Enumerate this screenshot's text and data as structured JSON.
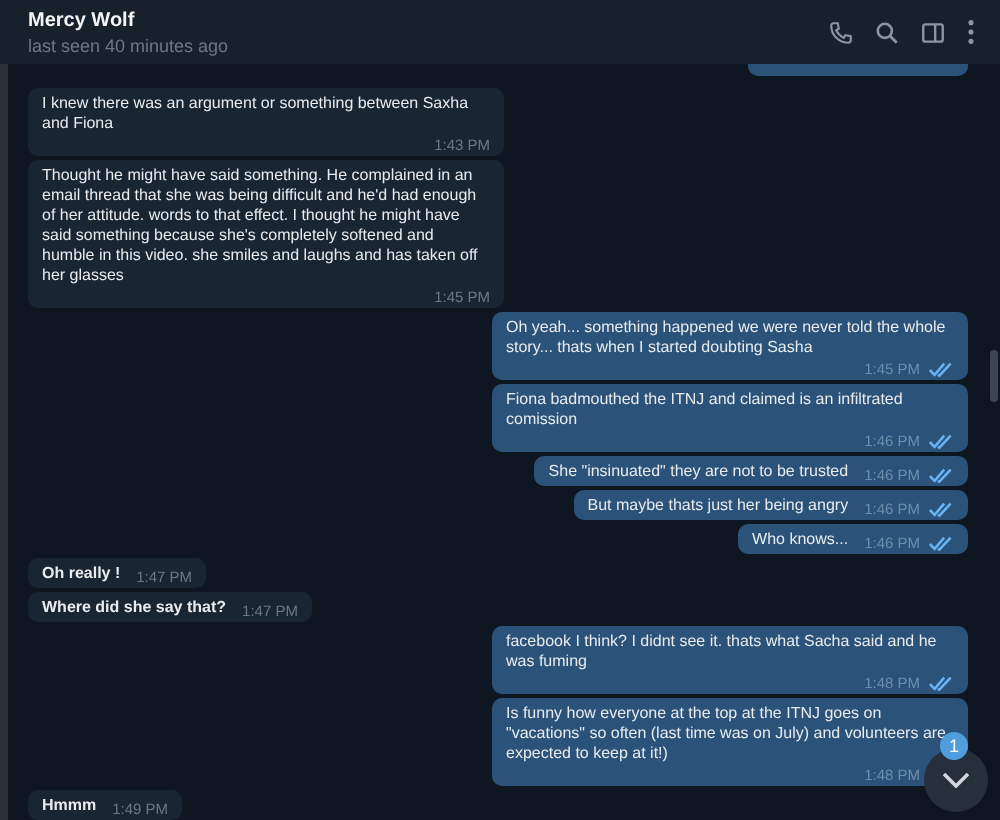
{
  "header": {
    "name": "Mercy Wolf",
    "status": "last seen 40 minutes ago"
  },
  "messages": [
    {
      "kind": "partial",
      "outgoing": true
    },
    {
      "kind": "text",
      "outgoing": false,
      "bold": false,
      "text": "I knew there was an argument or something between Saxha and Fiona",
      "time": "1:43 PM"
    },
    {
      "kind": "text",
      "outgoing": false,
      "bold": false,
      "text": "Thought he might have said something. He complained in an email thread that she was being difficult and he'd had enough of her attitude. words to that effect. I thought he might have said something because she's completely softened and humble in this video. she smiles and laughs and has taken off her glasses",
      "time": "1:45 PM"
    },
    {
      "kind": "text",
      "outgoing": true,
      "read": true,
      "text": "Oh yeah... something happened we were never told the whole story... thats when I started doubting Sasha",
      "time": "1:45 PM"
    },
    {
      "kind": "text",
      "outgoing": true,
      "read": true,
      "text": "Fiona badmouthed the ITNJ and claimed is an infiltrated comission",
      "time": "1:46 PM"
    },
    {
      "kind": "text",
      "outgoing": true,
      "read": true,
      "text": "She \"insinuated\" they are not to be trusted",
      "time": "1:46 PM"
    },
    {
      "kind": "text",
      "outgoing": true,
      "read": true,
      "text": "But maybe thats just her being angry",
      "time": "1:46 PM"
    },
    {
      "kind": "text",
      "outgoing": true,
      "read": true,
      "text": "Who knows...",
      "time": "1:46 PM"
    },
    {
      "kind": "text",
      "outgoing": false,
      "bold": true,
      "text": "Oh really !",
      "time": "1:47 PM"
    },
    {
      "kind": "text",
      "outgoing": false,
      "bold": true,
      "text": "Where did she say that?",
      "time": "1:47 PM"
    },
    {
      "kind": "text",
      "outgoing": true,
      "read": true,
      "text": "facebook I think? I didnt see it. thats what Sacha said and he was fuming",
      "time": "1:48 PM"
    },
    {
      "kind": "text",
      "outgoing": true,
      "text": "Is funny how everyone at the top at the ITNJ goes on \"vacations\" so often (last time was on July) and volunteers are expected to keep at it!)",
      "time": "1:48 PM"
    },
    {
      "kind": "text",
      "outgoing": false,
      "bold": true,
      "text": "Hmmm",
      "time": "1:49 PM"
    }
  ],
  "unread_badge": "1"
}
